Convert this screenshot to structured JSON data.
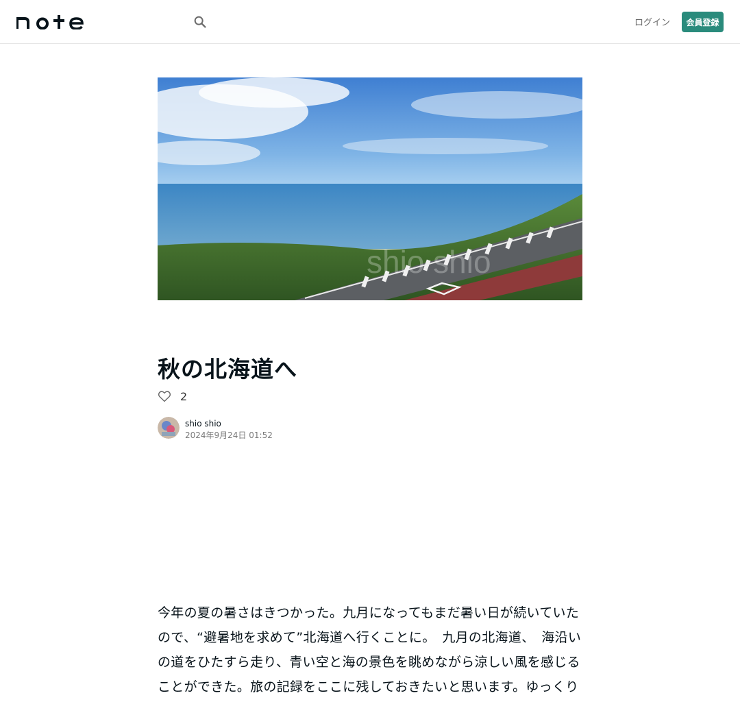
{
  "header": {
    "logo_text": "note",
    "search_label": "search",
    "login_label": "ログイン",
    "signup_label": "会員登録",
    "accent_color": "#2a8b7c"
  },
  "hero": {
    "watermark": "shio shio"
  },
  "article": {
    "title": "秋の北海道へ",
    "likes": "2",
    "author": "shio shio",
    "date": "2024年9月24日 01:52",
    "body": "今年の夏の暑さはきつかった。九月になってもまだ暑い日が続いていたので、“避暑地を求めて”北海道へ行くことに。　九月の北海道、　海沿いの道をひたすら走り、青い空と海の景色を眺めながら涼しい風を感じることができた。旅の記録をここに残しておきたいと思います。ゆっくりと思い出しながら書いていきます。"
  }
}
